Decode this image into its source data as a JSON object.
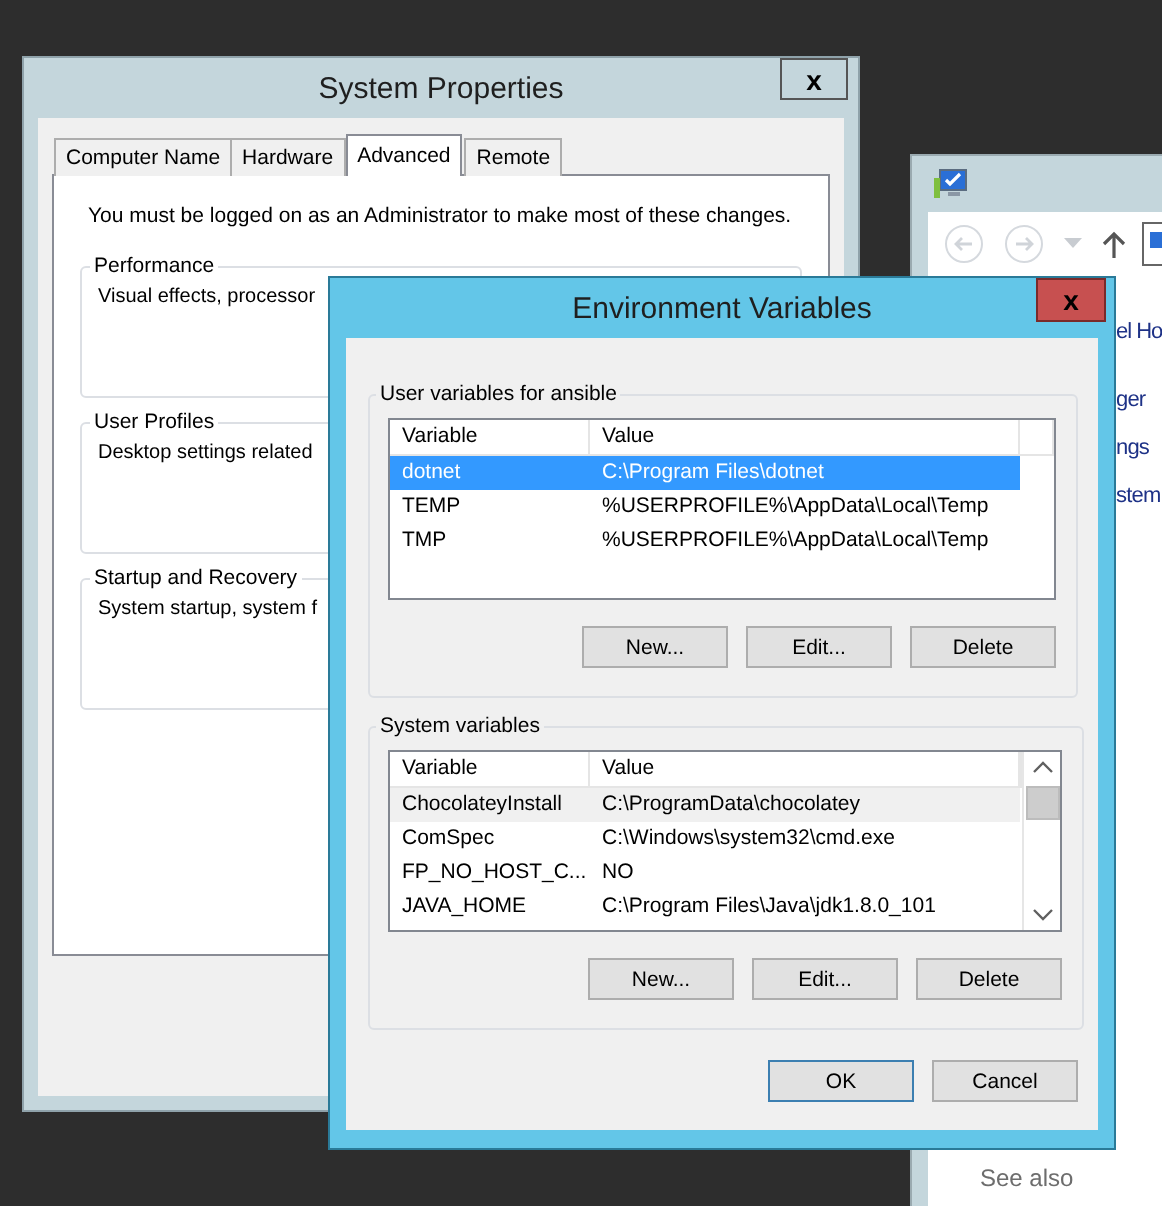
{
  "background_window": {
    "links": [
      {
        "text": "el Ho",
        "kind": "heading"
      },
      {
        "text": "ger",
        "kind": "link"
      },
      {
        "text": "ngs",
        "kind": "link"
      },
      {
        "text": "stem",
        "kind": "link"
      }
    ],
    "see_also": "See also"
  },
  "system_properties": {
    "title": "System Properties",
    "close": "x",
    "tabs": [
      {
        "label": "Computer Name",
        "selected": false
      },
      {
        "label": "Hardware",
        "selected": false
      },
      {
        "label": "Advanced",
        "selected": true
      },
      {
        "label": "Remote",
        "selected": false
      }
    ],
    "notice": "You must be logged on as an Administrator to make most of these changes.",
    "groups": [
      {
        "title": "Performance",
        "text": "Visual effects, processor"
      },
      {
        "title": "User Profiles",
        "text": "Desktop settings related"
      },
      {
        "title": "Startup and Recovery",
        "text": "System startup, system f"
      }
    ]
  },
  "environment_variables": {
    "title": "Environment Variables",
    "close": "x",
    "sections": [
      {
        "title": "User variables for ansible",
        "focused": true,
        "scrollbar": false,
        "columns": [
          "Variable",
          "Value"
        ],
        "rows": [
          {
            "variable": "dotnet",
            "value": "C:\\Program Files\\dotnet",
            "selected": true
          },
          {
            "variable": "TEMP",
            "value": "%USERPROFILE%\\AppData\\Local\\Temp",
            "selected": false
          },
          {
            "variable": "TMP",
            "value": "%USERPROFILE%\\AppData\\Local\\Temp",
            "selected": false
          }
        ],
        "buttons": [
          "New...",
          "Edit...",
          "Delete"
        ]
      },
      {
        "title": "System variables",
        "focused": false,
        "scrollbar": true,
        "columns": [
          "Variable",
          "Value"
        ],
        "rows": [
          {
            "variable": "ChocolateyInstall",
            "value": "C:\\ProgramData\\chocolatey",
            "selected": true
          },
          {
            "variable": "ComSpec",
            "value": "C:\\Windows\\system32\\cmd.exe",
            "selected": false
          },
          {
            "variable": "FP_NO_HOST_C...",
            "value": "NO",
            "selected": false
          },
          {
            "variable": "JAVA_HOME",
            "value": "C:\\Program Files\\Java\\jdk1.8.0_101",
            "selected": false
          }
        ],
        "buttons": [
          "New...",
          "Edit...",
          "Delete"
        ]
      }
    ],
    "buttons": [
      {
        "label": "OK",
        "default": true
      },
      {
        "label": "Cancel",
        "default": false
      }
    ]
  }
}
